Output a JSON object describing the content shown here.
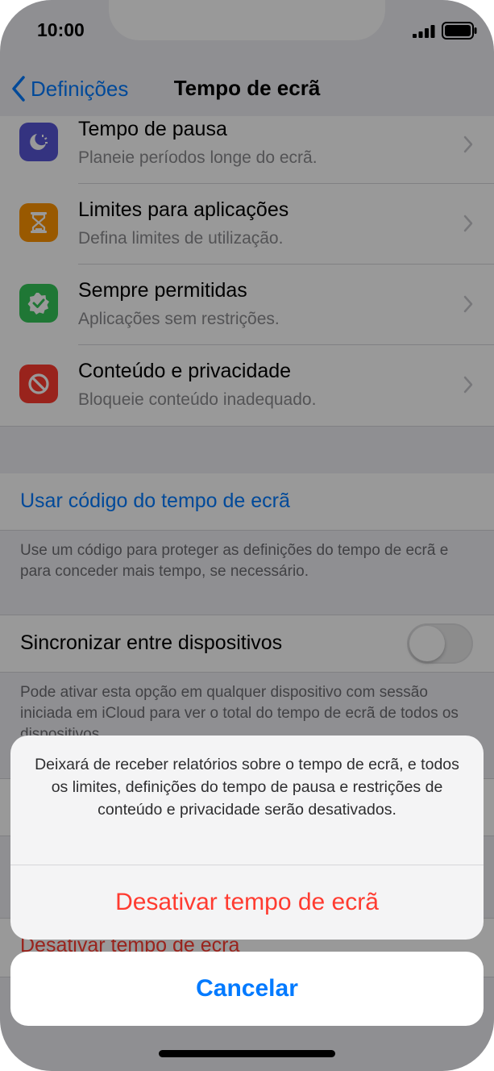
{
  "status": {
    "time": "10:00"
  },
  "nav": {
    "back_label": "Definições",
    "title": "Tempo de ecrã"
  },
  "list": [
    {
      "title": "Tempo de pausa",
      "subtitle": "Planeie períodos longe do ecrã.",
      "icon": "downtime-icon",
      "color": "#5856d6"
    },
    {
      "title": "Limites para aplicações",
      "subtitle": "Defina limites de utilização.",
      "icon": "hourglass-icon",
      "color": "#ff9500"
    },
    {
      "title": "Sempre permitidas",
      "subtitle": "Aplicações sem restrições.",
      "icon": "checkmark-seal-icon",
      "color": "#34c759"
    },
    {
      "title": "Conteúdo e privacidade",
      "subtitle": "Bloqueie conteúdo inadequado.",
      "icon": "restriction-icon",
      "color": "#ff3b30"
    }
  ],
  "passcode": {
    "link": "Usar código do tempo de ecrã",
    "footer": "Use um código para proteger as definições do tempo de ecrã e para conceder mais tempo, se necessário."
  },
  "sync": {
    "label": "Sincronizar entre dispositivos",
    "enabled": false,
    "footer": "Pode ativar esta opção em qualquer dispositivo com sessão iniciada em iCloud para ver o total do tempo de ecrã de todos os dispositivos."
  },
  "turn_off_label": "Desativar tempo de ecrã",
  "action_sheet": {
    "message": "Deixará de receber relatórios sobre o tempo de ecrã, e todos os limites, definições do tempo de pausa e restrições de conteúdo e privacidade serão desativados.",
    "destructive_label": "Desativar tempo de ecrã",
    "cancel_label": "Cancelar"
  },
  "colors": {
    "accent": "#007aff",
    "destructive": "#ff3b30"
  }
}
